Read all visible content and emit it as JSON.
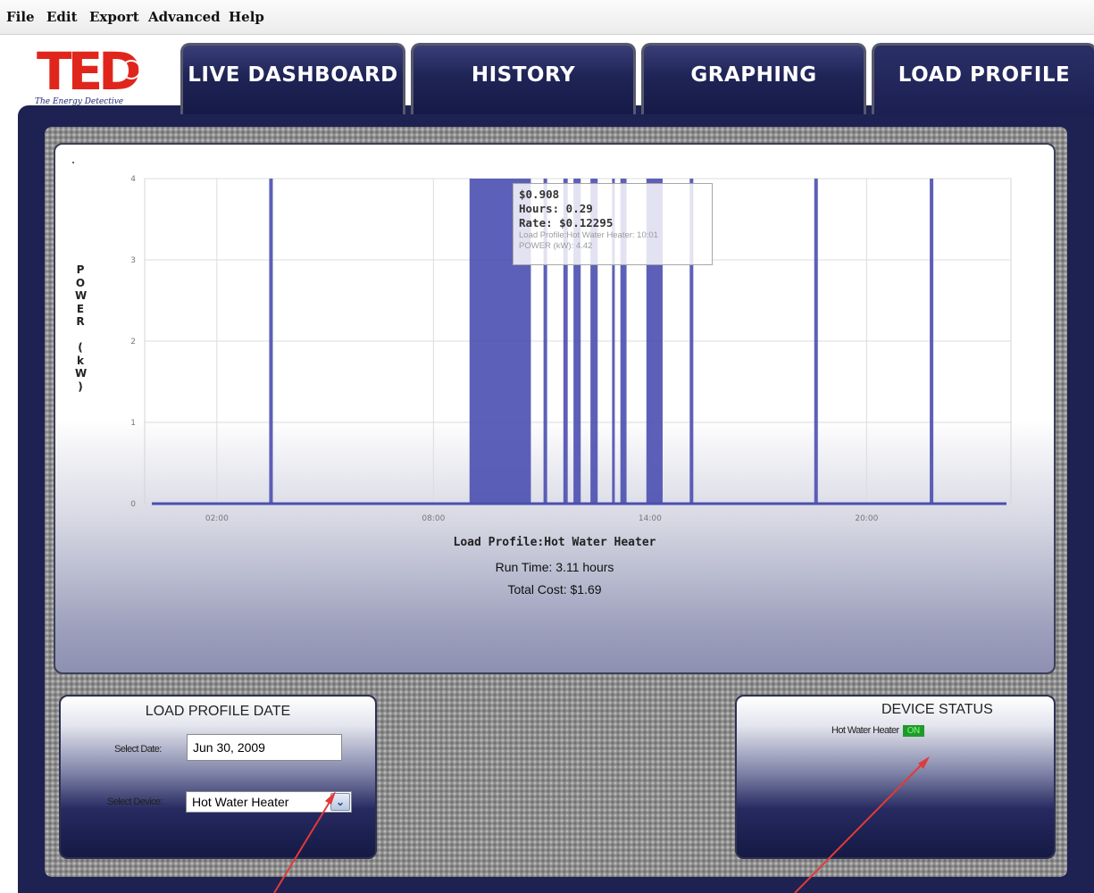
{
  "menu": {
    "items": [
      "File",
      "Edit",
      "Export",
      "Advanced",
      "Help"
    ]
  },
  "logo": {
    "letters": "TED",
    "tagline": "The Energy Detective"
  },
  "tabs": [
    {
      "label": "LIVE DASHBOARD",
      "active": false
    },
    {
      "label": "HISTORY",
      "active": false
    },
    {
      "label": "GRAPHING",
      "active": false
    },
    {
      "label": "LOAD PROFILE",
      "active": true
    }
  ],
  "colors": {
    "accent": "#1d2252",
    "bar": "#4b4fb0",
    "on_badge": "#1f9a2a"
  },
  "chart": {
    "tooltip": {
      "cost": "$0.908",
      "hours": "Hours: 0.29",
      "rate": "Rate: $0.12295",
      "series_line": "Load Profile:Hot Water Heater: 10:01",
      "power_line": "POWER (kW): 4.42"
    },
    "title": "Load Profile:Hot Water Heater",
    "run_time": "Run Time: 3.11 hours",
    "total_cost": "Total Cost: $1.69"
  },
  "chart_data": {
    "type": "bar",
    "title": "Load Profile:Hot Water Heater",
    "xlabel": "",
    "ylabel": "POWER (kW)",
    "ylim": [
      0,
      4
    ],
    "yticks": [
      0,
      1,
      2,
      3,
      4
    ],
    "xlim": [
      0,
      24
    ],
    "xticks": [
      {
        "value": 2,
        "label": "02:00"
      },
      {
        "value": 8,
        "label": "08:00"
      },
      {
        "value": 14,
        "label": "14:00"
      },
      {
        "value": 20,
        "label": "20:00"
      }
    ],
    "grid": true,
    "series": [
      {
        "intervals": [
          {
            "start": 3.45,
            "end": 3.55,
            "value": 4.42
          },
          {
            "start": 9.0,
            "end": 10.7,
            "value": 4.42
          },
          {
            "start": 11.05,
            "end": 11.15,
            "value": 4.42
          },
          {
            "start": 11.6,
            "end": 11.72,
            "value": 4.42
          },
          {
            "start": 11.88,
            "end": 12.08,
            "value": 4.42
          },
          {
            "start": 12.35,
            "end": 12.55,
            "value": 4.42
          },
          {
            "start": 12.95,
            "end": 13.0,
            "value": 4.42
          },
          {
            "start": 13.18,
            "end": 13.35,
            "value": 4.42
          },
          {
            "start": 13.9,
            "end": 14.35,
            "value": 4.42
          },
          {
            "start": 15.1,
            "end": 15.2,
            "value": 4.42
          },
          {
            "start": 18.55,
            "end": 18.65,
            "value": 4.42
          },
          {
            "start": 21.75,
            "end": 21.85,
            "value": 4.42
          }
        ]
      }
    ]
  },
  "load_profile_date": {
    "title": "LOAD PROFILE DATE",
    "date_label": "Select Date:",
    "date_value": "Jun 30, 2009",
    "device_label": "Select Device:",
    "device_value": "Hot Water Heater"
  },
  "device_status": {
    "title": "DEVICE STATUS",
    "device": "Hot Water Heater",
    "state": "ON"
  }
}
